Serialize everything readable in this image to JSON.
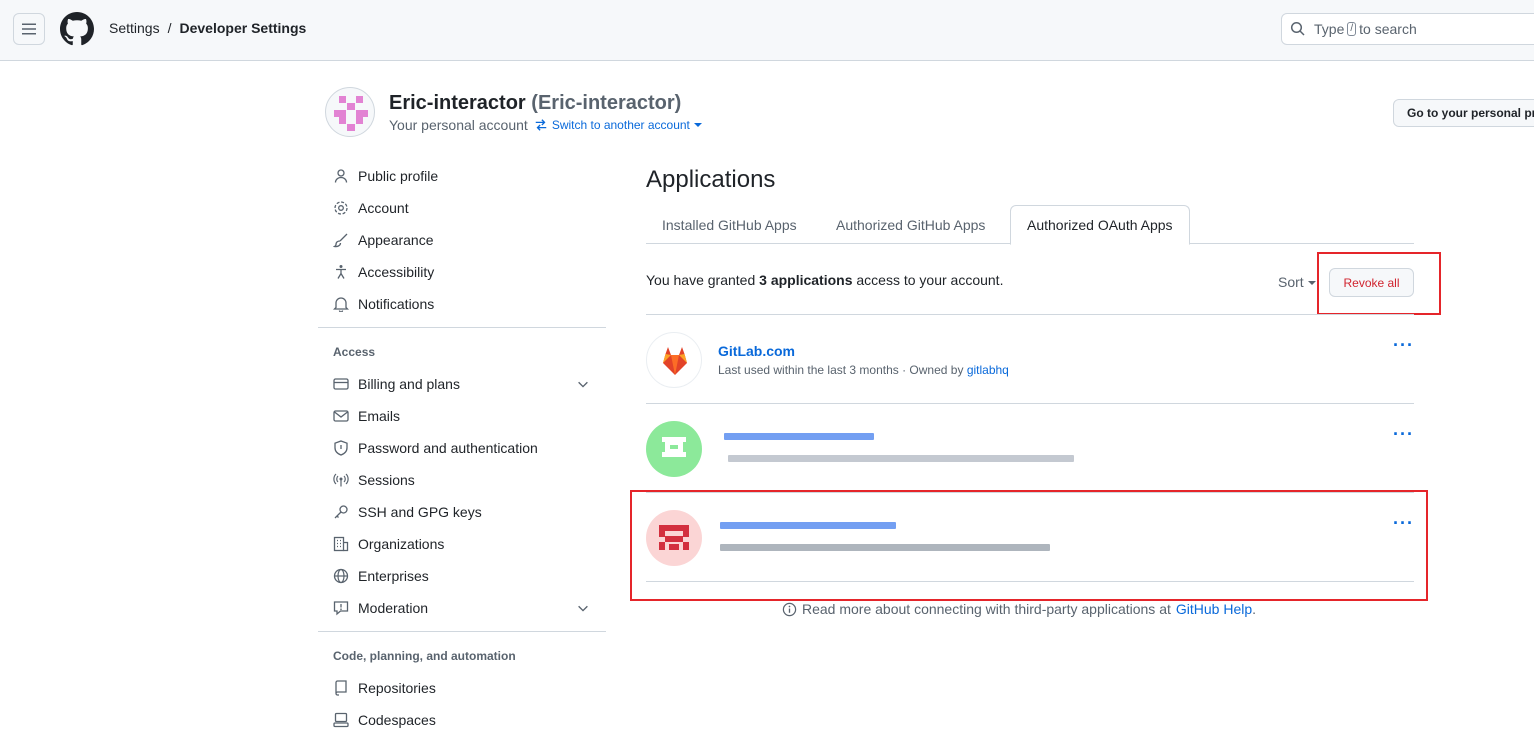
{
  "header": {
    "breadcrumb": [
      "Settings",
      "Developer Settings"
    ],
    "separator": "/",
    "search_prefix": "Type",
    "search_key": "/",
    "search_suffix": "to search"
  },
  "account": {
    "name": "Eric-interactor",
    "handle": "(Eric-interactor)",
    "subtitle": "Your personal account",
    "switch_label": "Switch to another account",
    "goto_button": "Go to your personal pr"
  },
  "sidebar": {
    "top_items": [
      {
        "label": "Public profile",
        "icon": "person-icon"
      },
      {
        "label": "Account",
        "icon": "gear-icon"
      },
      {
        "label": "Appearance",
        "icon": "paintbrush-icon"
      },
      {
        "label": "Accessibility",
        "icon": "accessibility-icon"
      },
      {
        "label": "Notifications",
        "icon": "bell-icon"
      }
    ],
    "access_heading": "Access",
    "access_items": [
      {
        "label": "Billing and plans",
        "icon": "credit-card-icon"
      },
      {
        "label": "Emails",
        "icon": "mail-icon"
      },
      {
        "label": "Password and authentication",
        "icon": "shield-icon"
      },
      {
        "label": "Sessions",
        "icon": "broadcast-icon"
      },
      {
        "label": "SSH and GPG keys",
        "icon": "key-icon"
      },
      {
        "label": "Organizations",
        "icon": "organization-icon"
      },
      {
        "label": "Enterprises",
        "icon": "globe-icon"
      },
      {
        "label": "Moderation",
        "icon": "report-icon"
      }
    ],
    "code_heading": "Code, planning, and automation",
    "code_items": [
      {
        "label": "Repositories",
        "icon": "repo-icon"
      },
      {
        "label": "Codespaces",
        "icon": "codespaces-icon"
      }
    ]
  },
  "main": {
    "title": "Applications",
    "tabs": [
      "Installed GitHub Apps",
      "Authorized GitHub Apps",
      "Authorized OAuth Apps"
    ],
    "active_tab": "Authorized OAuth Apps",
    "grant_prefix": "You have granted",
    "grant_count": "3 applications",
    "grant_suffix": "access to your account.",
    "sort_label": "Sort",
    "revoke_label": "Revoke all",
    "apps": [
      {
        "name": "GitLab.com",
        "meta_prefix": "Last used within the last 3 months · Owned by",
        "owner": "gitlabhq"
      }
    ],
    "dots": "···",
    "help_prefix": "Read more about connecting with third-party applications at",
    "help_link": "GitHub Help",
    "help_suffix": "."
  },
  "colors": {
    "link": "#0969da",
    "danger": "#d1242f",
    "highlight": "#e5252a"
  }
}
